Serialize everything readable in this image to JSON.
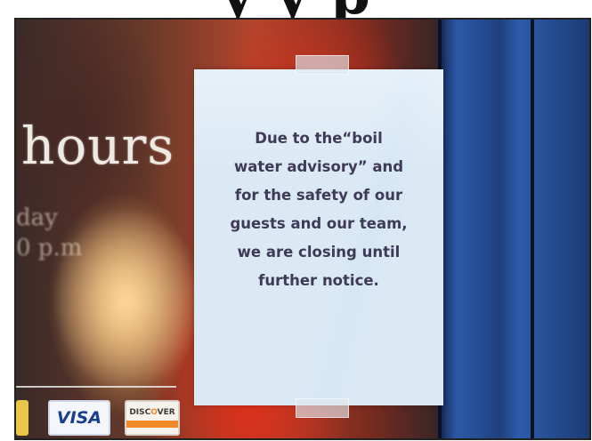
{
  "headline_fragment": "y y p",
  "window_sign": {
    "word": "hours",
    "line2": "day",
    "line3": "0 p.m"
  },
  "notice": {
    "lines": [
      "Due to the“boil",
      "water advisory” and",
      "for the safety of our",
      "guests and our team,",
      "we are closing until",
      "further notice."
    ]
  },
  "payment_stickers": {
    "visa": "VISA",
    "discover_pre": "DISC",
    "discover_o": "O",
    "discover_post": "VER"
  },
  "colors": {
    "notice_paper": "#dbe9f4",
    "notice_text": "#3f3a57",
    "door_blue": "#2b58a5",
    "window_red": "#b3452c"
  }
}
